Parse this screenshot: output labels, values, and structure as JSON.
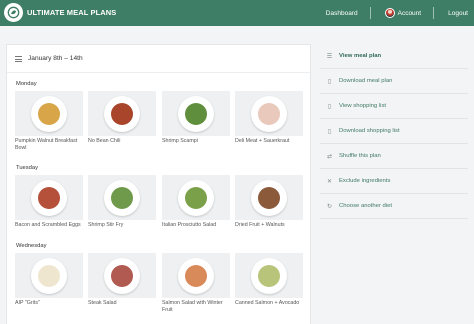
{
  "brand": {
    "name": "ULTIMATE MEAL PLANS"
  },
  "nav": {
    "dashboard": "Dashboard",
    "account": "Account",
    "logout": "Logout"
  },
  "plan": {
    "date_range": "January 8th – 14th"
  },
  "days": [
    {
      "label": "Monday",
      "meals": [
        {
          "name": "Pumpkin Walnut Breakfast Bowl",
          "food_color": "#d8a648"
        },
        {
          "name": "No Bean Chili",
          "food_color": "#a8452a"
        },
        {
          "name": "Shrimp Scampi",
          "food_color": "#5f8f3d"
        },
        {
          "name": "Deli Meat + Sauerkraut",
          "food_color": "#e8c9bb"
        }
      ]
    },
    {
      "label": "Tuesday",
      "meals": [
        {
          "name": "Bacon and Scrambled Eggs",
          "food_color": "#b5503a"
        },
        {
          "name": "Shrimp Stir Fry",
          "food_color": "#6f9a4b"
        },
        {
          "name": "Italian Prosciutto Salad",
          "food_color": "#7aa04a"
        },
        {
          "name": "Dried Fruit + Walnuts",
          "food_color": "#8a5a3a"
        }
      ]
    },
    {
      "label": "Wednesday",
      "meals": [
        {
          "name": "AIP \"Grits\"",
          "food_color": "#efe6cf"
        },
        {
          "name": "Steak Salad",
          "food_color": "#b05a52"
        },
        {
          "name": "Salmon Salad with Winter Fruit",
          "food_color": "#d98a5a"
        },
        {
          "name": "Canned Salmon + Avocado",
          "food_color": "#b8c47a"
        }
      ]
    }
  ],
  "sidebar": {
    "items": [
      {
        "label": "View meal plan",
        "icon": "list-icon",
        "glyph": "☰"
      },
      {
        "label": "Download meal plan",
        "icon": "document-icon",
        "glyph": "▯"
      },
      {
        "label": "View shopping list",
        "icon": "document-icon",
        "glyph": "▯"
      },
      {
        "label": "Download shopping list",
        "icon": "document-icon",
        "glyph": "▯"
      },
      {
        "label": "Shuffle this plan",
        "icon": "shuffle-icon",
        "glyph": "⇄"
      },
      {
        "label": "Exclude ingredients",
        "icon": "close-icon",
        "glyph": "✕"
      },
      {
        "label": "Choose another diet",
        "icon": "refresh-icon",
        "glyph": "↻"
      }
    ]
  },
  "colors": {
    "brand_green": "#3e7e66",
    "link_green": "#3f7a64"
  }
}
